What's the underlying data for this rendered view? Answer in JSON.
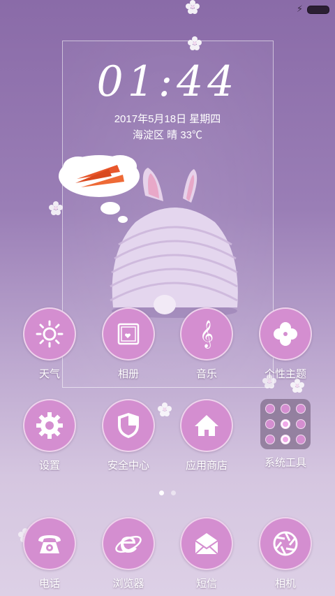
{
  "status_bar": {
    "charging_icon": "lightning-icon",
    "battery_icon": "battery-icon"
  },
  "widget": {
    "time": "01:44",
    "date": "2017年5月18日 星期四",
    "weather": "海淀区  晴  33℃"
  },
  "apps_row1": [
    {
      "label": "天气",
      "icon": "sun-icon"
    },
    {
      "label": "相册",
      "icon": "photo-album-icon"
    },
    {
      "label": "音乐",
      "icon": "treble-clef-icon"
    },
    {
      "label": "个性主题",
      "icon": "clover-icon"
    }
  ],
  "apps_row2": [
    {
      "label": "设置",
      "icon": "gear-icon"
    },
    {
      "label": "安全中心",
      "icon": "shield-icon"
    },
    {
      "label": "应用商店",
      "icon": "house-icon"
    },
    {
      "label": "系统工具",
      "icon": "folder-icon"
    }
  ],
  "dock": [
    {
      "label": "电话",
      "icon": "telephone-icon"
    },
    {
      "label": "浏览器",
      "icon": "browser-e-icon"
    },
    {
      "label": "短信",
      "icon": "envelope-icon"
    },
    {
      "label": "相机",
      "icon": "camera-aperture-icon"
    }
  ],
  "page_indicator": {
    "pages": 2,
    "current": 1
  },
  "colors": {
    "icon_fill": "#d48ed0",
    "background_top": "#8a6ba8",
    "background_bottom": "#ddd0e6"
  }
}
